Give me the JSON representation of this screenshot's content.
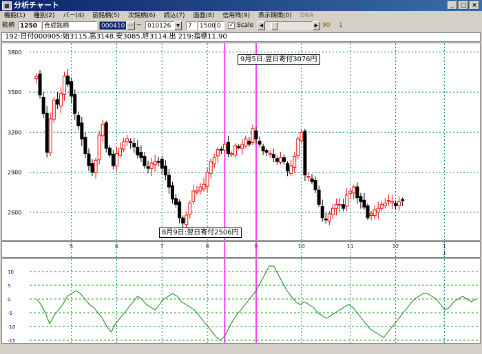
{
  "window": {
    "title": "分析チャート",
    "icon": "chart-app-icon"
  },
  "menu": [
    {
      "label": "機能(1)"
    },
    {
      "label": "種別(2)"
    },
    {
      "label": "バー(4)"
    },
    {
      "label": "前銘柄(5)"
    },
    {
      "label": "次銘柄(6)"
    },
    {
      "label": "読込(7)"
    },
    {
      "label": "画面(8)"
    },
    {
      "label": "信用残(9)"
    },
    {
      "label": "表示期間(0)"
    },
    {
      "label": "DNA",
      "disabled": true
    }
  ],
  "toolbar": {
    "symbol_label": "銘柄",
    "symbol_code": "1250",
    "symbol_name": "合成銘柄",
    "start_date": "000410",
    "dash": "─",
    "end_date": "010126",
    "param1": "7",
    "param2": "1500",
    "param3": "0",
    "scale_checked": "✓",
    "scale_label": "Scale",
    "scale_value": "90",
    "scale_extra": "1",
    "slider_position": 0.15
  },
  "info_line": "192:日付000905:始3115.高3148.安3085.終3114.出 219:指標11.90",
  "callouts": {
    "top": "9月5日:翌日寄付3076円",
    "bottom": "8月9日:翌日寄付2506円"
  },
  "colors": {
    "up": "#ff0000",
    "down": "#000000",
    "grid": "#008080",
    "marker": "#ff00ff",
    "indicator": "#007f00",
    "grid_h_lower": "#00a000"
  },
  "chart_data": [
    {
      "type": "candlestick",
      "y_ticks": [
        {
          "value": 3800,
          "label": "3800"
        },
        {
          "value": 3500,
          "label": "3500"
        },
        {
          "value": 3200,
          "label": "3200"
        },
        {
          "value": 2900,
          "label": "2900"
        },
        {
          "value": 2600,
          "label": "2600"
        }
      ],
      "ylim": [
        2420,
        3840
      ],
      "x_ticks": [
        {
          "i": 10,
          "label": "5"
        },
        {
          "i": 23,
          "label": "6"
        },
        {
          "i": 36,
          "label": "7"
        },
        {
          "i": 49,
          "label": "8"
        },
        {
          "i": 63,
          "label": "9"
        },
        {
          "i": 76,
          "label": "10"
        },
        {
          "i": 90,
          "label": "11"
        },
        {
          "i": 103,
          "label": "12"
        },
        {
          "i": 117,
          "label": "1"
        }
      ],
      "x_subtick": {
        "i": 117,
        "label": "1"
      },
      "markers": [
        54,
        63
      ],
      "n_points": 127,
      "close_series": [
        3620,
        3480,
        3340,
        3050,
        3300,
        3440,
        3410,
        3490,
        3620,
        3560,
        3470,
        3340,
        3250,
        3150,
        3040,
        2950,
        2900,
        2990,
        3180,
        3260,
        3080,
        3030,
        2950,
        3040,
        3080,
        3130,
        3150,
        3130,
        3090,
        3030,
        3010,
        2950,
        2930,
        2970,
        2980,
        2980,
        2930,
        2880,
        2790,
        2700,
        2660,
        2560,
        2520,
        2580,
        2670,
        2760,
        2760,
        2790,
        2810,
        2900,
        2980,
        3010,
        3070,
        3070,
        3110,
        3040,
        3040,
        3100,
        3090,
        3110,
        3150,
        3110,
        3230,
        3150,
        3110,
        3060,
        3050,
        3040,
        3010,
        2980,
        3010,
        2980,
        2910,
        2950,
        3020,
        3150,
        3200,
        2880,
        2870,
        2830,
        2770,
        2660,
        2560,
        2550,
        2590,
        2630,
        2660,
        2660,
        2630,
        2730,
        2760,
        2790,
        2710,
        2680,
        2640,
        2560,
        2590,
        2620,
        2630,
        2660,
        2670,
        2690,
        2680,
        2650,
        2680,
        2690
      ]
    },
    {
      "type": "line",
      "y_ticks": [
        {
          "value": 10,
          "label": "10"
        },
        {
          "value": 5,
          "label": "5"
        },
        {
          "value": 0,
          "label": "0"
        },
        {
          "value": -5,
          "label": "-5"
        },
        {
          "value": -10,
          "label": "-10"
        },
        {
          "value": -15,
          "label": "-15"
        }
      ],
      "ylim": [
        -15.5,
        13.5
      ],
      "values": [
        0,
        -2,
        -5,
        -9,
        -6,
        -4,
        -2,
        1,
        2,
        3,
        2,
        0,
        -2,
        -3,
        -5,
        -7,
        -10,
        -12,
        -9,
        -7,
        -5,
        -3,
        -1,
        1,
        0,
        -2,
        -3,
        -4,
        -2,
        0,
        1,
        2,
        1,
        -1,
        -2,
        -3,
        -4,
        -6,
        -8,
        -10,
        -12,
        -14,
        -15,
        -13,
        -10,
        -7,
        -5,
        -3,
        -1,
        1,
        3,
        6,
        9,
        12,
        12,
        9,
        6,
        3,
        1,
        -1,
        -2,
        -1,
        -2,
        -3,
        -5,
        -6,
        -7,
        -6,
        -5,
        -4,
        -3,
        -2,
        -3,
        -5,
        -7,
        -9,
        -11,
        -12,
        -13,
        -14,
        -12,
        -10,
        -8,
        -6,
        -4,
        -2,
        0,
        1,
        2,
        2,
        1,
        0,
        -2,
        -4,
        -3,
        -1,
        0,
        1,
        0,
        -1,
        0
      ]
    }
  ]
}
